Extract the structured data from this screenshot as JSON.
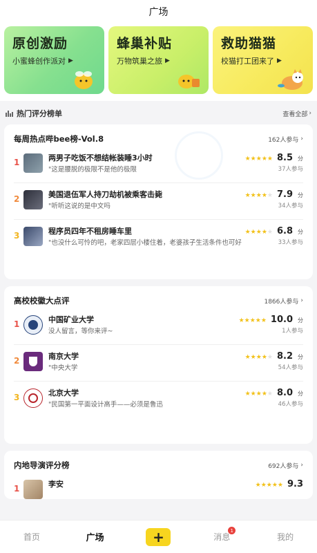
{
  "header": {
    "title": "广场"
  },
  "banners": [
    {
      "title": "原创激励",
      "subtitle": "小蜜蜂创作派对"
    },
    {
      "title": "蜂巢补贴",
      "subtitle": "万物筑巢之旅"
    },
    {
      "title": "救助猫猫",
      "subtitle": "校猫打工团来了"
    }
  ],
  "hot_section": {
    "label": "热门评分榜单",
    "see_all": "查看全部"
  },
  "cards": [
    {
      "title": "每周热点哔bee榜-Vol.8",
      "count": "162人参与",
      "items": [
        {
          "rank": "1",
          "name": "两男子吃饭不想结帐装睡3小时",
          "comment": "\"这是腰脱的极限不是他的极限",
          "score": "8.5",
          "unit": "分",
          "participants": "37人参与",
          "stars": 4.5
        },
        {
          "rank": "2",
          "name": "美国退伍军人持刀劫机被乘客击毙",
          "comment": "\"听听这说的是中文吗",
          "score": "7.9",
          "unit": "分",
          "participants": "34人参与",
          "stars": 4
        },
        {
          "rank": "3",
          "name": "程序员四年不租房睡车里",
          "comment": "\"也没什么可怜的吧，老家四层小楼住着，老婆孩子生活条件也可好",
          "score": "6.8",
          "unit": "分",
          "participants": "33人参与",
          "stars": 3.5
        }
      ]
    },
    {
      "title": "高校校徽大点评",
      "count": "1866人参与",
      "items": [
        {
          "rank": "1",
          "name": "中国矿业大学",
          "comment": "没人留言，等你来评~",
          "score": "10.0",
          "unit": "分",
          "participants": "1人参与",
          "stars": 5
        },
        {
          "rank": "2",
          "name": "南京大学",
          "comment": "\"中央大学",
          "score": "8.2",
          "unit": "分",
          "participants": "54人参与",
          "stars": 4
        },
        {
          "rank": "3",
          "name": "北京大学",
          "comment": "\"民国第一平面设计高手——必须是鲁迅",
          "score": "8.0",
          "unit": "分",
          "participants": "46人参与",
          "stars": 4
        }
      ]
    },
    {
      "title": "内地导演评分榜",
      "count": "692人参与",
      "items": [
        {
          "rank": "1",
          "name": "李安",
          "score": "9.3",
          "stars": 5
        }
      ]
    }
  ],
  "tabbar": {
    "home": "首页",
    "square": "广场",
    "plus": "+",
    "messages": "消息",
    "messages_badge": "1",
    "me": "我的"
  },
  "colors": {
    "accent_yellow": "#f7d51f",
    "rank1": "#e8534a",
    "rank2": "#f08a3c",
    "rank3": "#f2b520",
    "star": "#f2c11a"
  }
}
